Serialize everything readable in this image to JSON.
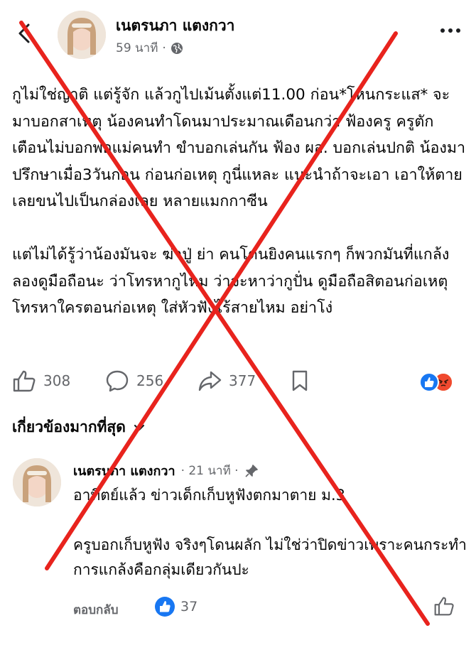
{
  "header": {
    "author": "เนตรนภา แตงกวา",
    "time": "59 นาที",
    "privacy_icon": "globe-icon"
  },
  "post": {
    "text": "กูไม่ใช่ญาติ แต่รู้จัก แล้วกูไปเม้นตั้งแต่11.00 ก่อน*โหนกระแส* จะมาบอกสาเหตุ น้องคนทำโดนมาประมาณเดือนกว่า ฟ้องครู ครูตักเตือนไม่บอกพ่อแม่คนทำ ขำบอกเล่นกัน ฟ้อง ผอ. บอกเล่นปกติ น้องมาปรึกษาเมื่อ3วันก่อน ก่อนก่อเหตุ กูนี่แหละ แนะนำถ้าจะเอา เอาให้ตาย เลยขนไปเป็นกล่องเลย หลายแมกกาซีน\n\nแต่ไม่ได้รู้ว่าน้องมันจะ ฆ่าปู่ ย่า คนโดนยิงคนแรกๆ ก็พวกมันที่แกล้ง ลองดูมือถือนะ ว่าโทรหากูไหม ว่าจะหาว่ากูปั่น ดูมือถือสิตอนก่อเหตุโทรหาใครตอนก่อเหตุ ใส่หัวฟังไร้สายไหม อย่าโง่"
  },
  "actions": {
    "likes": "308",
    "comments": "256",
    "shares": "377"
  },
  "section": {
    "title": "เกี่ยวข้องมากที่สุด"
  },
  "comment": {
    "author": "เนตรนภา แตงกวา",
    "time": "· 21 นาที ·",
    "text": "อาทิตย์แล้ว ข่าวเด็กเก็บหูฟังตกมาตาย ม.3\n\nครูบอกเก็บหูฟัง จริงๆโดนผลัก ไม่ใช่ว่าปิดข่าวเพราะคนกระทำการแกล้งคือกลุ่มเดียวกันปะ",
    "reply_label": "ตอบกลับ",
    "likes": "37"
  },
  "colors": {
    "accent": "#1877f2",
    "overlay_x": "#e8231d",
    "muted": "#65676b"
  }
}
